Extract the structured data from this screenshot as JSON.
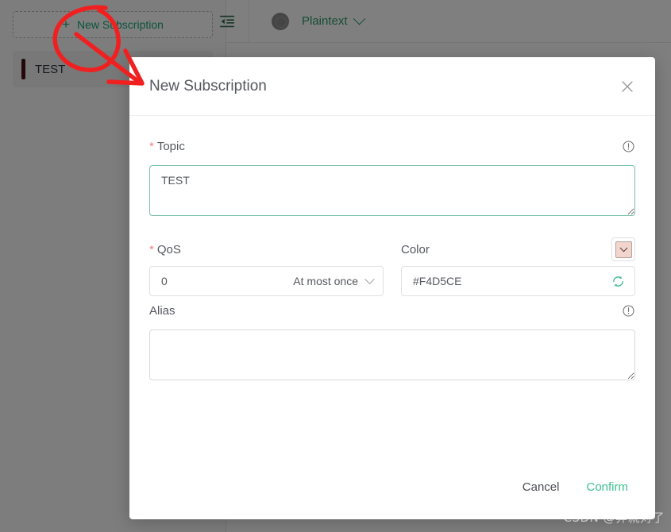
{
  "sidebar": {
    "new_subscription_button": "New Subscription",
    "plus_icon": "plus-icon",
    "items": [
      {
        "label": "TEST",
        "color": "#4A1214"
      }
    ]
  },
  "toolbar": {
    "fold_icon": "menu-fold-icon",
    "avatar_icon": "avatar-icon",
    "format_label": "Plaintext",
    "format_chevron": "chevron-down-icon"
  },
  "dialog": {
    "title": "New Subscription",
    "close_icon": "close-icon",
    "fields": {
      "topic": {
        "label": "Topic",
        "required_marker": "*",
        "value": "TEST",
        "placeholder": "",
        "info_icon": "info-circle-icon"
      },
      "qos": {
        "label": "QoS",
        "required_marker": "*",
        "value": "0",
        "description": "At most once",
        "chevron": "chevron-down-icon"
      },
      "color": {
        "label": "Color",
        "value": "#F4D5CE",
        "swatch_color": "#F4D5CE",
        "swatch_chevron": "chevron-down-icon",
        "refresh_icon": "refresh-icon"
      },
      "alias": {
        "label": "Alias",
        "value": "",
        "placeholder": "",
        "info_icon": "info-circle-icon"
      }
    },
    "footer": {
      "cancel_label": "Cancel",
      "confirm_label": "Confirm"
    }
  },
  "annotation": {
    "shape": "hand-drawn-circle-and-arrow",
    "color": "#F02020"
  },
  "watermark": {
    "text": "CSDN @莽就对了"
  },
  "colors": {
    "accent_green": "#3EC191",
    "required_red": "#F0808A",
    "overlay": "#7E7E7E"
  }
}
